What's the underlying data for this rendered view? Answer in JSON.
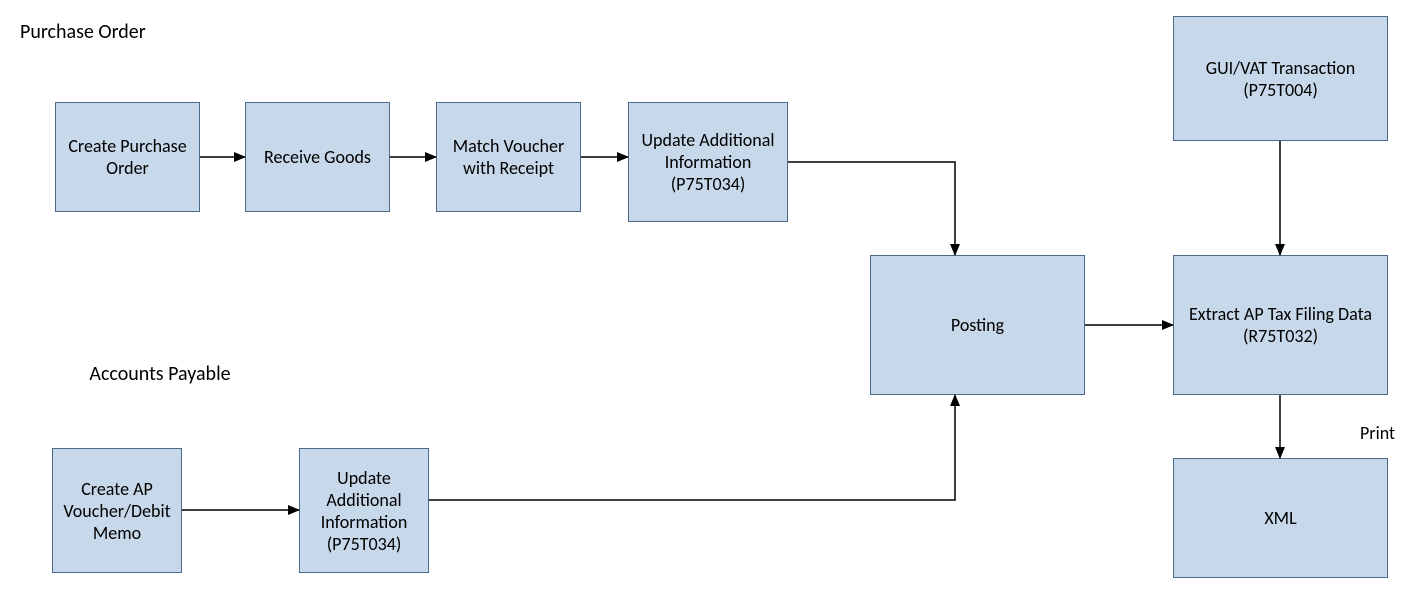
{
  "sections": {
    "purchase_order_title": "Purchase Order",
    "accounts_payable_title": "Accounts Payable"
  },
  "nodes": {
    "create_po": "Create Purchase Order",
    "receive_goods": "Receive Goods",
    "match_voucher": "Match Voucher with Receipt",
    "update_info_po": "Update Additional Information (P75T034)",
    "create_ap": "Create AP Voucher/Debit Memo",
    "update_info_ap": "Update Additional Information (P75T034)",
    "posting": "Posting",
    "gui_vat": "GUI/VAT Transaction (P75T004)",
    "extract_ap": "Extract AP Tax Filing Data (R75T032)",
    "xml": "XML"
  },
  "labels": {
    "print": "Print"
  },
  "chart_data": {
    "type": "flowchart",
    "nodes": [
      {
        "id": "create_po",
        "label": "Create Purchase Order",
        "group": "Purchase Order"
      },
      {
        "id": "receive_goods",
        "label": "Receive Goods",
        "group": "Purchase Order"
      },
      {
        "id": "match_voucher",
        "label": "Match Voucher with Receipt",
        "group": "Purchase Order"
      },
      {
        "id": "update_info_po",
        "label": "Update Additional Information (P75T034)",
        "group": "Purchase Order"
      },
      {
        "id": "create_ap",
        "label": "Create AP Voucher/Debit Memo",
        "group": "Accounts Payable"
      },
      {
        "id": "update_info_ap",
        "label": "Update Additional Information (P75T034)",
        "group": "Accounts Payable"
      },
      {
        "id": "posting",
        "label": "Posting"
      },
      {
        "id": "gui_vat",
        "label": "GUI/VAT Transaction (P75T004)"
      },
      {
        "id": "extract_ap",
        "label": "Extract AP Tax Filing Data (R75T032)"
      },
      {
        "id": "xml",
        "label": "XML"
      }
    ],
    "edges": [
      {
        "from": "create_po",
        "to": "receive_goods"
      },
      {
        "from": "receive_goods",
        "to": "match_voucher"
      },
      {
        "from": "match_voucher",
        "to": "update_info_po"
      },
      {
        "from": "update_info_po",
        "to": "posting"
      },
      {
        "from": "create_ap",
        "to": "update_info_ap"
      },
      {
        "from": "update_info_ap",
        "to": "posting"
      },
      {
        "from": "posting",
        "to": "extract_ap"
      },
      {
        "from": "gui_vat",
        "to": "extract_ap"
      },
      {
        "from": "extract_ap",
        "to": "xml",
        "label": "Print"
      }
    ]
  }
}
